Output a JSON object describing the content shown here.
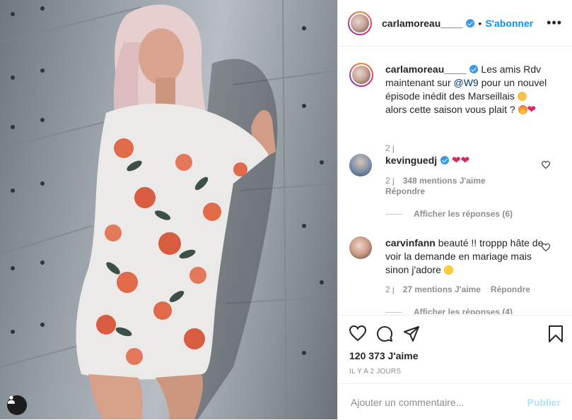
{
  "header": {
    "username": "carlamoreau____",
    "dot": "•",
    "follow_label": "S'abonner",
    "more_label": "•••"
  },
  "caption": {
    "username": "carlamoreau____",
    "text_1": "Les amis Rdv maintenant sur",
    "mention": "@W9",
    "text_2": "pour un nouvel épisode inédit des Marseillais",
    "text_3": "alors cette saison vous plait ?",
    "time": "2 j"
  },
  "comments": [
    {
      "username": "kevinguedj",
      "text": "",
      "time": "2 j",
      "likes": "348 mentions J'aime",
      "reply_label": "Répondre",
      "view_replies": "Afficher les réponses (6)"
    },
    {
      "username": "carvinfann",
      "text": "beauté !! troppp hâte de voir la demande en mariage mais sinon j'adore",
      "time": "2 j",
      "likes": "27 mentions J'aime",
      "reply_label": "Répondre",
      "view_replies": "Afficher les réponses (4)"
    }
  ],
  "likes_count": "120 373 J'aime",
  "posted_when": "IL Y A 2 JOURS",
  "add_comment": {
    "placeholder": "Ajouter un commentaire...",
    "post_label": "Publier"
  },
  "colors": {
    "accent": "#0095f6",
    "heart": "#e0245e",
    "muted": "#8e8e8e"
  },
  "icons": [
    "user-tag-icon",
    "verified-icon",
    "more-icon",
    "heart-icon",
    "comment-icon",
    "share-icon",
    "bookmark-icon"
  ]
}
